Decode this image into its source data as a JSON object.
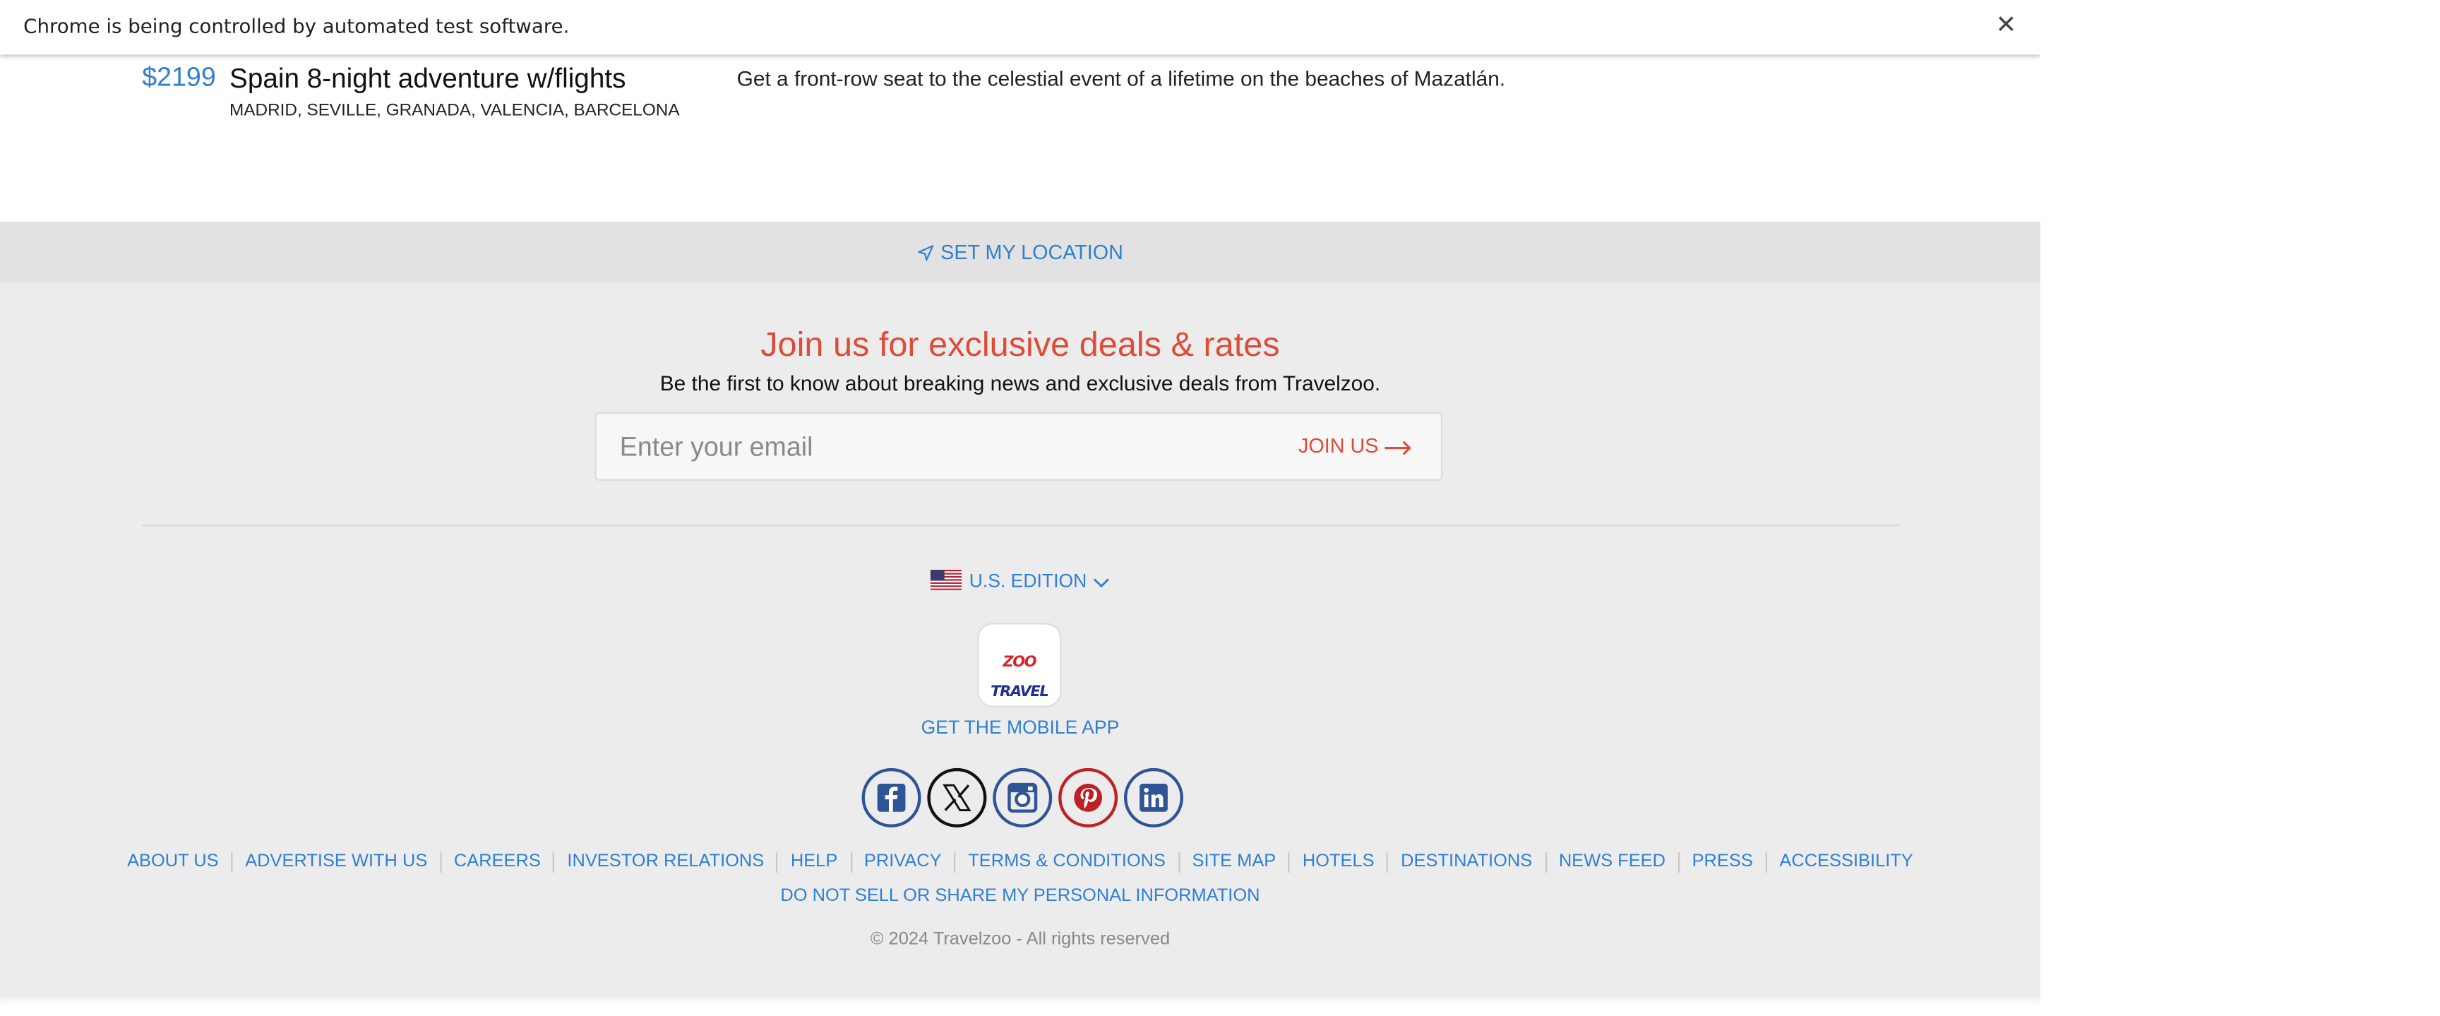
{
  "infobar": {
    "message": "Chrome is being controlled by automated test software.",
    "close_glyph": "✕"
  },
  "deal": {
    "price": "$2199",
    "title": "Spain 8-night adventure w/flights",
    "cities": "MADRID, SEVILLE, GRANADA, VALENCIA, BARCELONA",
    "blurb": "Get a front-row seat to the celestial event of a lifetime on the beaches of Mazatlán."
  },
  "location": {
    "label": "SET MY LOCATION",
    "icon": "navigation-arrow-icon"
  },
  "newsletter": {
    "title": "Join us for exclusive deals & rates",
    "subtitle": "Be the first to know about breaking news and exclusive deals from Travelzoo.",
    "placeholder": "Enter your email",
    "button_label": "JOIN US"
  },
  "edition": {
    "label": "U.S. EDITION",
    "flag_icon": "us-flag-icon"
  },
  "app": {
    "logo_text_a": "TRAVEL",
    "logo_text_b": "ZOO",
    "link_label": "GET THE MOBILE APP"
  },
  "social": [
    "facebook",
    "x",
    "instagram",
    "pinterest",
    "linkedin"
  ],
  "colors": {
    "link_blue": "#2f7fd4",
    "accent_red": "#dd4b39",
    "footer_bg": "#ececec",
    "location_bg": "#e2e2e2",
    "social_blue": "#2f5596",
    "pinterest_red": "#bd2126"
  },
  "footer_links": [
    "ABOUT US",
    "ADVERTISE WITH US",
    "CAREERS",
    "INVESTOR RELATIONS",
    "HELP",
    "PRIVACY",
    "TERMS & CONDITIONS",
    "SITE MAP",
    "HOTELS",
    "DESTINATIONS",
    "NEWS FEED",
    "PRESS",
    "ACCESSIBILITY"
  ],
  "do_not_sell": "DO NOT SELL OR SHARE MY PERSONAL INFORMATION",
  "copyright": "© 2024 Travelzoo - All rights reserved"
}
